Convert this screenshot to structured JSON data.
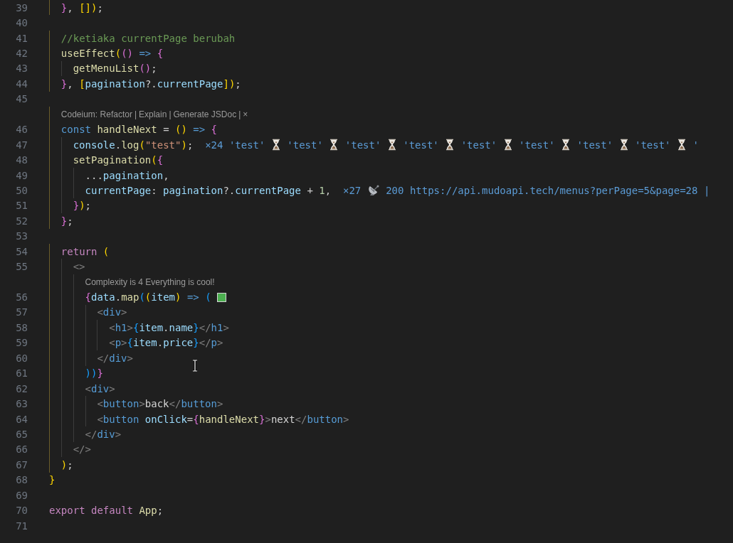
{
  "editor": {
    "lines": [
      {
        "number": "39",
        "guides": [
          {
            "active": true
          }
        ],
        "tokens": [
          {
            "text": "}",
            "kind": "b2"
          },
          {
            "text": ", ",
            "kind": "p"
          },
          {
            "text": "[])",
            "kind": "b1"
          },
          {
            "text": ";",
            "kind": "p"
          }
        ]
      },
      {
        "number": "40"
      },
      {
        "number": "41",
        "guides": [
          {
            "active": true
          }
        ],
        "tokens": [
          {
            "text": "//ketiaka currentPage berubah",
            "kind": "cm"
          }
        ]
      },
      {
        "number": "42",
        "guides": [
          {
            "active": true
          }
        ],
        "tokens": [
          {
            "text": "useEffect",
            "kind": "fn"
          },
          {
            "text": "(",
            "kind": "b1"
          },
          {
            "text": "()",
            "kind": "b2"
          },
          {
            "text": " => ",
            "kind": "kw"
          },
          {
            "text": "{",
            "kind": "b2"
          }
        ]
      },
      {
        "number": "43",
        "guides": [
          {
            "active": true
          },
          {
            "active": false
          }
        ],
        "tokens": [
          {
            "text": "getMenuList",
            "kind": "fn"
          },
          {
            "text": "()",
            "kind": "b2"
          },
          {
            "text": ";",
            "kind": "p"
          }
        ]
      },
      {
        "number": "44",
        "guides": [
          {
            "active": true
          }
        ],
        "tokens": [
          {
            "text": "}",
            "kind": "b2"
          },
          {
            "text": ", ",
            "kind": "p"
          },
          {
            "text": "[",
            "kind": "b1"
          },
          {
            "text": "pagination",
            "kind": "var"
          },
          {
            "text": "?.",
            "kind": "p"
          },
          {
            "text": "currentPage",
            "kind": "var"
          },
          {
            "text": "])",
            "kind": "b1"
          },
          {
            "text": ";",
            "kind": "p"
          }
        ]
      },
      {
        "number": "45"
      },
      {
        "kind": "lens",
        "guides": [
          {
            "active": true
          }
        ],
        "items": [
          "Codeium: Refactor",
          "Explain",
          "Generate JSDoc"
        ],
        "separator": "|",
        "close": "×"
      },
      {
        "number": "46",
        "guides": [
          {
            "active": true
          }
        ],
        "tokens": [
          {
            "text": "const ",
            "kind": "kw"
          },
          {
            "text": "handleNext",
            "kind": "fn"
          },
          {
            "text": " = ",
            "kind": "p"
          },
          {
            "text": "()",
            "kind": "b1"
          },
          {
            "text": " => ",
            "kind": "kw"
          },
          {
            "text": "{",
            "kind": "b2"
          }
        ]
      },
      {
        "number": "47",
        "guides": [
          {
            "active": true
          },
          {
            "active": false
          }
        ],
        "tokens": [
          {
            "text": "console",
            "kind": "var"
          },
          {
            "text": ".",
            "kind": "p"
          },
          {
            "text": "log",
            "kind": "fn"
          },
          {
            "text": "(",
            "kind": "b1"
          },
          {
            "text": "\"test\"",
            "kind": "str"
          },
          {
            "text": ")",
            "kind": "b1"
          },
          {
            "text": ";",
            "kind": "p"
          },
          {
            "text": "  ×24 'test' ",
            "kind": "hint"
          },
          {
            "kind": "hourglass"
          },
          {
            "text": " 'test' ",
            "kind": "hint"
          },
          {
            "kind": "hourglass"
          },
          {
            "text": " 'test' ",
            "kind": "hint"
          },
          {
            "kind": "hourglass"
          },
          {
            "text": " 'test' ",
            "kind": "hint"
          },
          {
            "kind": "hourglass"
          },
          {
            "text": " 'test' ",
            "kind": "hint"
          },
          {
            "kind": "hourglass"
          },
          {
            "text": " 'test' ",
            "kind": "hint"
          },
          {
            "kind": "hourglass"
          },
          {
            "text": " 'test' ",
            "kind": "hint"
          },
          {
            "kind": "hourglass"
          },
          {
            "text": " 'test' ",
            "kind": "hint"
          },
          {
            "kind": "hourglass"
          },
          {
            "text": " '",
            "kind": "hint"
          }
        ]
      },
      {
        "number": "48",
        "guides": [
          {
            "active": true
          },
          {
            "active": false
          }
        ],
        "tokens": [
          {
            "text": "setPagination",
            "kind": "fn"
          },
          {
            "text": "(",
            "kind": "b1"
          },
          {
            "text": "{",
            "kind": "b2"
          }
        ]
      },
      {
        "number": "49",
        "guides": [
          {
            "active": true
          },
          {
            "active": false
          },
          {
            "active": false
          }
        ],
        "tokens": [
          {
            "text": "...",
            "kind": "p"
          },
          {
            "text": "pagination",
            "kind": "var"
          },
          {
            "text": ",",
            "kind": "p"
          }
        ]
      },
      {
        "number": "50",
        "guides": [
          {
            "active": true
          },
          {
            "active": false
          },
          {
            "active": false
          }
        ],
        "tokens": [
          {
            "text": "currentPage",
            "kind": "var"
          },
          {
            "text": ": ",
            "kind": "p"
          },
          {
            "text": "pagination",
            "kind": "var"
          },
          {
            "text": "?.",
            "kind": "p"
          },
          {
            "text": "currentPage",
            "kind": "var"
          },
          {
            "text": " + ",
            "kind": "p"
          },
          {
            "text": "1",
            "kind": "num"
          },
          {
            "text": ",",
            "kind": "p"
          },
          {
            "text": "  ×27 ",
            "kind": "hint"
          },
          {
            "kind": "satellite"
          },
          {
            "text": " 200 https://api.mudoapi.tech/menus?perPage=5&page=28 |",
            "kind": "hint"
          }
        ]
      },
      {
        "number": "51",
        "guides": [
          {
            "active": true
          },
          {
            "active": false
          }
        ],
        "tokens": [
          {
            "text": "}",
            "kind": "b2"
          },
          {
            "text": ")",
            "kind": "b1"
          },
          {
            "text": ";",
            "kind": "p"
          }
        ]
      },
      {
        "number": "52",
        "guides": [
          {
            "active": true
          }
        ],
        "tokens": [
          {
            "text": "}",
            "kind": "b2"
          },
          {
            "text": ";",
            "kind": "p"
          }
        ]
      },
      {
        "number": "53"
      },
      {
        "number": "54",
        "guides": [
          {
            "active": true
          }
        ],
        "tokens": [
          {
            "text": "return ",
            "kind": "ctl"
          },
          {
            "text": "(",
            "kind": "b1"
          }
        ]
      },
      {
        "number": "55",
        "guides": [
          {
            "active": true
          },
          {
            "active": false
          }
        ],
        "tokens": [
          {
            "text": "<>",
            "kind": "tag"
          }
        ]
      },
      {
        "kind": "lens",
        "guides": [
          {
            "active": true
          },
          {
            "active": false
          },
          {
            "active": false
          }
        ],
        "items": [
          "Complexity is 4 Everything is cool!"
        ]
      },
      {
        "number": "56",
        "guides": [
          {
            "active": true
          },
          {
            "active": false
          },
          {
            "active": false
          }
        ],
        "tokens": [
          {
            "text": "{",
            "kind": "b2"
          },
          {
            "text": "data",
            "kind": "var"
          },
          {
            "text": ".",
            "kind": "p"
          },
          {
            "text": "map",
            "kind": "fn"
          },
          {
            "text": "(",
            "kind": "b3"
          },
          {
            "text": "(",
            "kind": "b1"
          },
          {
            "text": "item",
            "kind": "var"
          },
          {
            "text": ")",
            "kind": "b1"
          },
          {
            "text": " => ",
            "kind": "kw"
          },
          {
            "text": "( ",
            "kind": "b3"
          },
          {
            "kind": "swatch",
            "color": "#4caf50"
          }
        ]
      },
      {
        "number": "57",
        "guides": [
          {
            "active": true
          },
          {
            "active": false
          },
          {
            "active": false
          },
          {
            "active": false
          }
        ],
        "tokens": [
          {
            "text": "<",
            "kind": "tag"
          },
          {
            "text": "div",
            "kind": "tn"
          },
          {
            "text": ">",
            "kind": "tag"
          }
        ]
      },
      {
        "number": "58",
        "guides": [
          {
            "active": true
          },
          {
            "active": false
          },
          {
            "active": false
          },
          {
            "active": false
          },
          {
            "active": false
          }
        ],
        "tokens": [
          {
            "text": "<",
            "kind": "tag"
          },
          {
            "text": "h1",
            "kind": "tn"
          },
          {
            "text": ">",
            "kind": "tag"
          },
          {
            "text": "{",
            "kind": "b3"
          },
          {
            "text": "item",
            "kind": "var"
          },
          {
            "text": ".",
            "kind": "p"
          },
          {
            "text": "name",
            "kind": "var"
          },
          {
            "text": "}",
            "kind": "b3"
          },
          {
            "text": "</",
            "kind": "tag"
          },
          {
            "text": "h1",
            "kind": "tn"
          },
          {
            "text": ">",
            "kind": "tag"
          }
        ]
      },
      {
        "number": "59",
        "guides": [
          {
            "active": true
          },
          {
            "active": false
          },
          {
            "active": false
          },
          {
            "active": false
          },
          {
            "active": false
          }
        ],
        "tokens": [
          {
            "text": "<",
            "kind": "tag"
          },
          {
            "text": "p",
            "kind": "tn"
          },
          {
            "text": ">",
            "kind": "tag"
          },
          {
            "text": "{",
            "kind": "b3"
          },
          {
            "text": "item",
            "kind": "var"
          },
          {
            "text": ".",
            "kind": "p"
          },
          {
            "text": "price",
            "kind": "var"
          },
          {
            "text": "}",
            "kind": "b3"
          },
          {
            "text": "</",
            "kind": "tag"
          },
          {
            "text": "p",
            "kind": "tn"
          },
          {
            "text": ">",
            "kind": "tag"
          }
        ]
      },
      {
        "number": "60",
        "guides": [
          {
            "active": true
          },
          {
            "active": false
          },
          {
            "active": false
          },
          {
            "active": false
          }
        ],
        "tokens": [
          {
            "text": "</",
            "kind": "tag"
          },
          {
            "text": "div",
            "kind": "tn"
          },
          {
            "text": ">",
            "kind": "tag"
          }
        ]
      },
      {
        "number": "61",
        "guides": [
          {
            "active": true
          },
          {
            "active": false
          },
          {
            "active": false
          }
        ],
        "tokens": [
          {
            "text": "))",
            "kind": "b3"
          },
          {
            "text": "}",
            "kind": "b2"
          }
        ]
      },
      {
        "number": "62",
        "guides": [
          {
            "active": true
          },
          {
            "active": false
          },
          {
            "active": false
          }
        ],
        "tokens": [
          {
            "text": "<",
            "kind": "tag"
          },
          {
            "text": "div",
            "kind": "tn"
          },
          {
            "text": ">",
            "kind": "tag"
          }
        ]
      },
      {
        "number": "63",
        "guides": [
          {
            "active": true
          },
          {
            "active": false
          },
          {
            "active": false
          },
          {
            "active": false
          }
        ],
        "tokens": [
          {
            "text": "<",
            "kind": "tag"
          },
          {
            "text": "button",
            "kind": "tn"
          },
          {
            "text": ">",
            "kind": "tag"
          },
          {
            "text": "back",
            "kind": "txt"
          },
          {
            "text": "</",
            "kind": "tag"
          },
          {
            "text": "button",
            "kind": "tn"
          },
          {
            "text": ">",
            "kind": "tag"
          }
        ]
      },
      {
        "number": "64",
        "guides": [
          {
            "active": true
          },
          {
            "active": false
          },
          {
            "active": false
          },
          {
            "active": false
          }
        ],
        "tokens": [
          {
            "text": "<",
            "kind": "tag"
          },
          {
            "text": "button ",
            "kind": "tn"
          },
          {
            "text": "onClick",
            "kind": "attr"
          },
          {
            "text": "=",
            "kind": "p"
          },
          {
            "text": "{",
            "kind": "b2"
          },
          {
            "text": "handleNext",
            "kind": "fn"
          },
          {
            "text": "}",
            "kind": "b2"
          },
          {
            "text": ">",
            "kind": "tag"
          },
          {
            "text": "next",
            "kind": "txt"
          },
          {
            "text": "</",
            "kind": "tag"
          },
          {
            "text": "button",
            "kind": "tn"
          },
          {
            "text": ">",
            "kind": "tag"
          }
        ]
      },
      {
        "number": "65",
        "guides": [
          {
            "active": true
          },
          {
            "active": false
          },
          {
            "active": false
          }
        ],
        "tokens": [
          {
            "text": "</",
            "kind": "tag"
          },
          {
            "text": "div",
            "kind": "tn"
          },
          {
            "text": ">",
            "kind": "tag"
          }
        ]
      },
      {
        "number": "66",
        "guides": [
          {
            "active": true
          },
          {
            "active": false
          }
        ],
        "tokens": [
          {
            "text": "</>",
            "kind": "tag"
          }
        ]
      },
      {
        "number": "67",
        "guides": [
          {
            "active": true
          }
        ],
        "tokens": [
          {
            "text": ")",
            "kind": "b1"
          },
          {
            "text": ";",
            "kind": "p"
          }
        ]
      },
      {
        "number": "68",
        "tokens": [
          {
            "text": "}",
            "kind": "b1"
          }
        ]
      },
      {
        "number": "69"
      },
      {
        "number": "70",
        "tokens": [
          {
            "text": "export default ",
            "kind": "ctl"
          },
          {
            "text": "App",
            "kind": "fn"
          },
          {
            "text": ";",
            "kind": "p"
          }
        ]
      },
      {
        "number": "71"
      }
    ]
  }
}
